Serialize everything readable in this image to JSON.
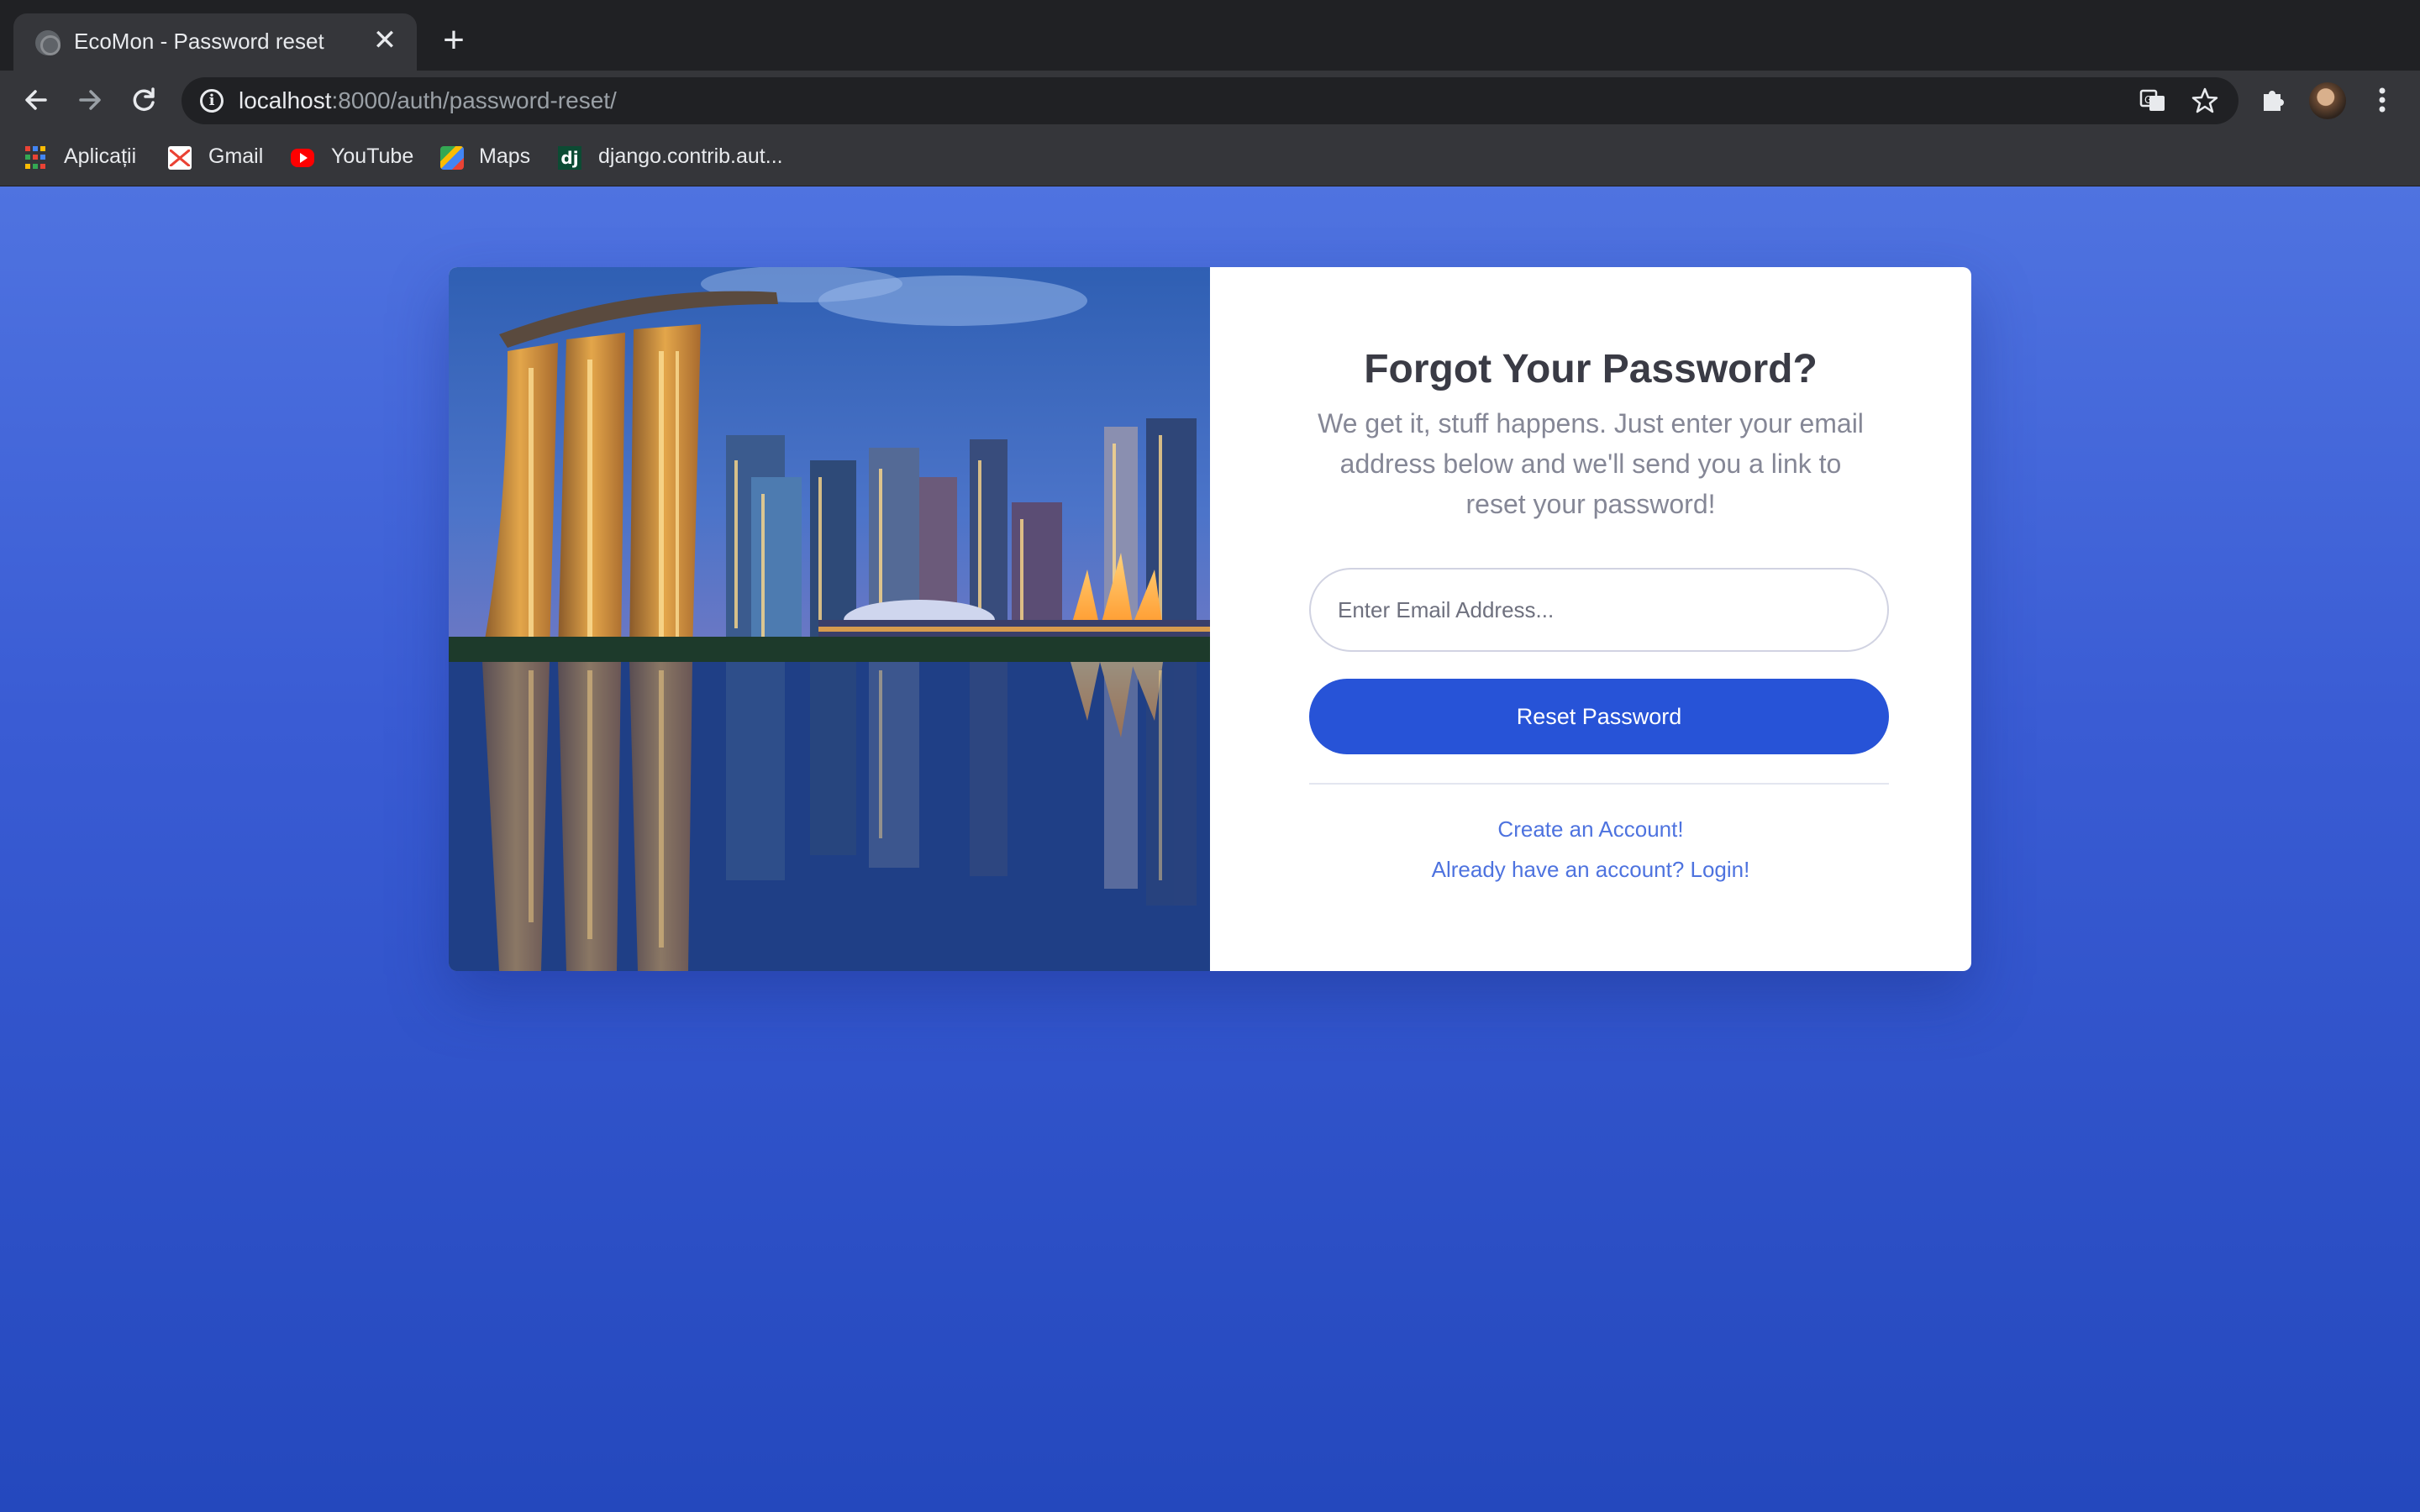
{
  "browser": {
    "tab_title": "EcoMon - Password reset",
    "tab_close": "✕",
    "new_tab": "+",
    "url_host": "localhost",
    "url_rest": ":8000/auth/password-reset/",
    "bookmarks": [
      {
        "label": "Aplicații",
        "icon": "apps-grid-icon"
      },
      {
        "label": "Gmail",
        "icon": "gmail-icon"
      },
      {
        "label": "YouTube",
        "icon": "youtube-icon"
      },
      {
        "label": "Maps",
        "icon": "maps-icon"
      },
      {
        "label": "django.contrib.aut...",
        "icon": "django-icon",
        "icon_text": "dj"
      }
    ]
  },
  "page": {
    "heading": "Forgot Your Password?",
    "subtext": "We get it, stuff happens. Just enter your email address below and we'll send you a link to reset your password!",
    "email_placeholder": "Enter Email Address...",
    "reset_button": "Reset Password",
    "create_account_link": "Create an Account!",
    "login_link": "Already have an account? Login!"
  },
  "colors": {
    "primary": "#2753d7",
    "link": "#4e73df",
    "background_top": "#4f73e0",
    "background_bottom": "#2448bd"
  }
}
